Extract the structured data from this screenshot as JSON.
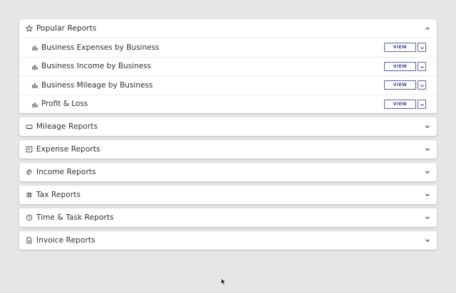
{
  "popular": {
    "title": "Popular Reports",
    "icon": "star-icon",
    "items": [
      {
        "label": "Business Expenses by Business",
        "view_label": "VIEW"
      },
      {
        "label": "Business Income by Business",
        "view_label": "VIEW"
      },
      {
        "label": "Business Mileage by Business",
        "view_label": "VIEW"
      },
      {
        "label": "Profit & Loss",
        "view_label": "VIEW"
      }
    ]
  },
  "sections": [
    {
      "title": "Mileage Reports",
      "icon": "car-icon"
    },
    {
      "title": "Expense Reports",
      "icon": "receipt-icon"
    },
    {
      "title": "Income Reports",
      "icon": "money-icon"
    },
    {
      "title": "Tax Reports",
      "icon": "grid-icon"
    },
    {
      "title": "Time & Task Reports",
      "icon": "clock-icon"
    },
    {
      "title": "Invoice Reports",
      "icon": "document-icon"
    }
  ],
  "colors": {
    "accent": "#3b3f9c",
    "background": "#e6e6e6"
  }
}
